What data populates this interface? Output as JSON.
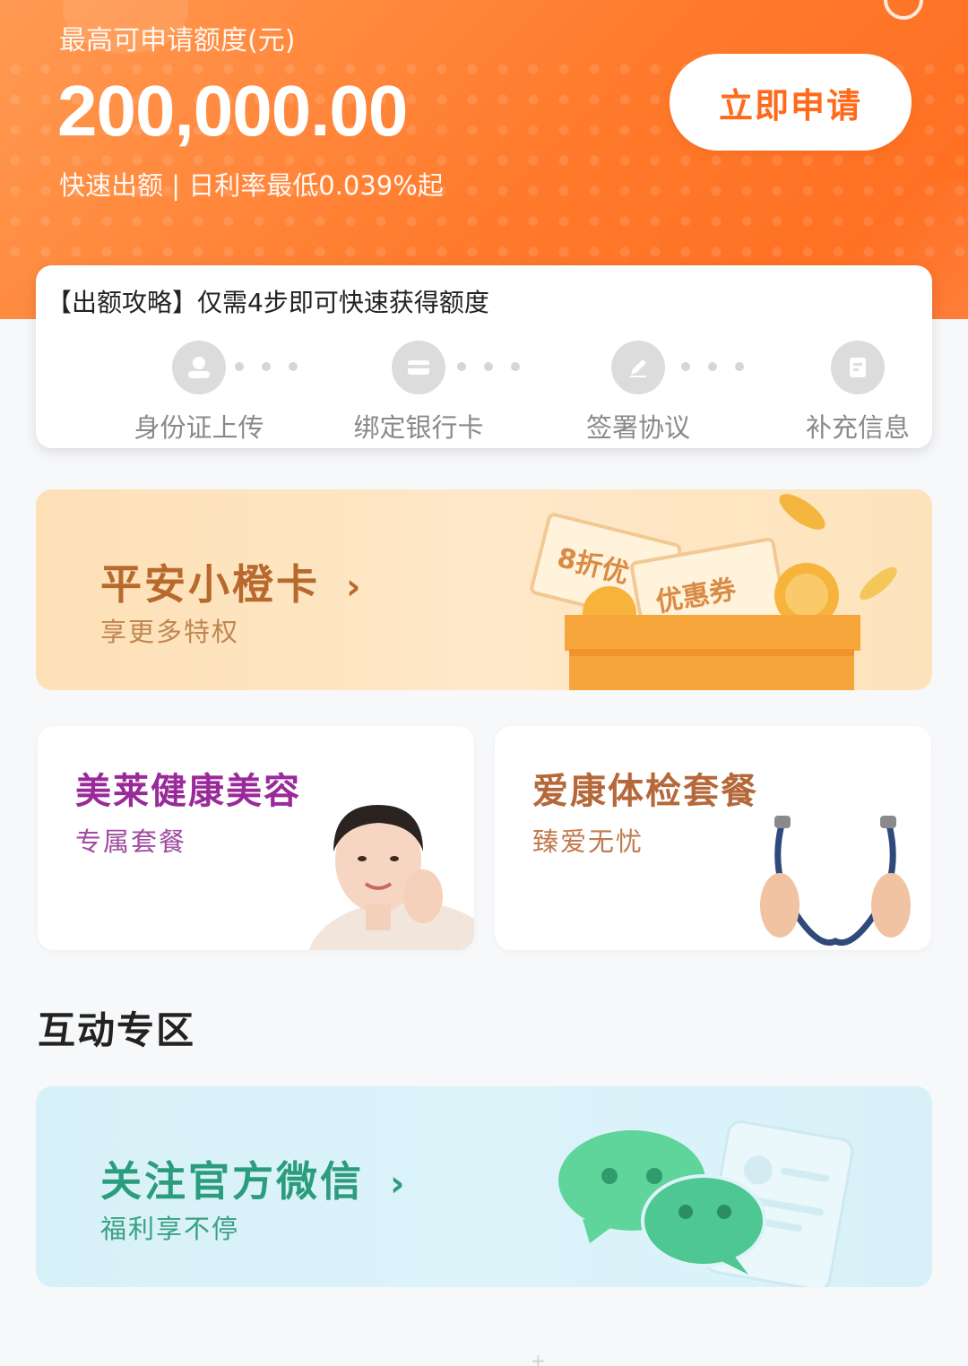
{
  "hero": {
    "limit_label": "最高可申请额度(元)",
    "limit_amount": "200,000.00",
    "limit_sub": "快速出额 | 日利率最低0.039%起",
    "apply_label": "立即申请"
  },
  "guide": {
    "title": "【出额攻略】仅需4步即可快速获得额度",
    "steps": [
      {
        "label": "身份证上传",
        "icon": "id-card-user-icon"
      },
      {
        "label": "绑定银行卡",
        "icon": "bank-card-icon"
      },
      {
        "label": "签署协议",
        "icon": "pen-sign-icon"
      },
      {
        "label": "补充信息",
        "icon": "document-info-icon"
      }
    ]
  },
  "promo_card": {
    "title": "平安小橙卡",
    "subtitle": "享更多特权",
    "coupon_discount": "8折优",
    "coupon_label": "优惠券"
  },
  "services": [
    {
      "title": "美莱健康美容",
      "subtitle": "专属套餐",
      "title_color": "#9a2a9a",
      "subtitle_color": "#a04aa0"
    },
    {
      "title": "爱康体检套餐",
      "subtitle": "臻爱无忧",
      "title_color": "#b5683a",
      "subtitle_color": "#c07a4e"
    }
  ],
  "interactive": {
    "section_title": "互动专区",
    "wechat_title": "关注官方微信",
    "wechat_subtitle": "福利享不停"
  },
  "colors": {
    "brand_orange": "#ff7a2c",
    "apply_text": "#ff6a1a",
    "wechat_green": "#2b9d7c"
  }
}
